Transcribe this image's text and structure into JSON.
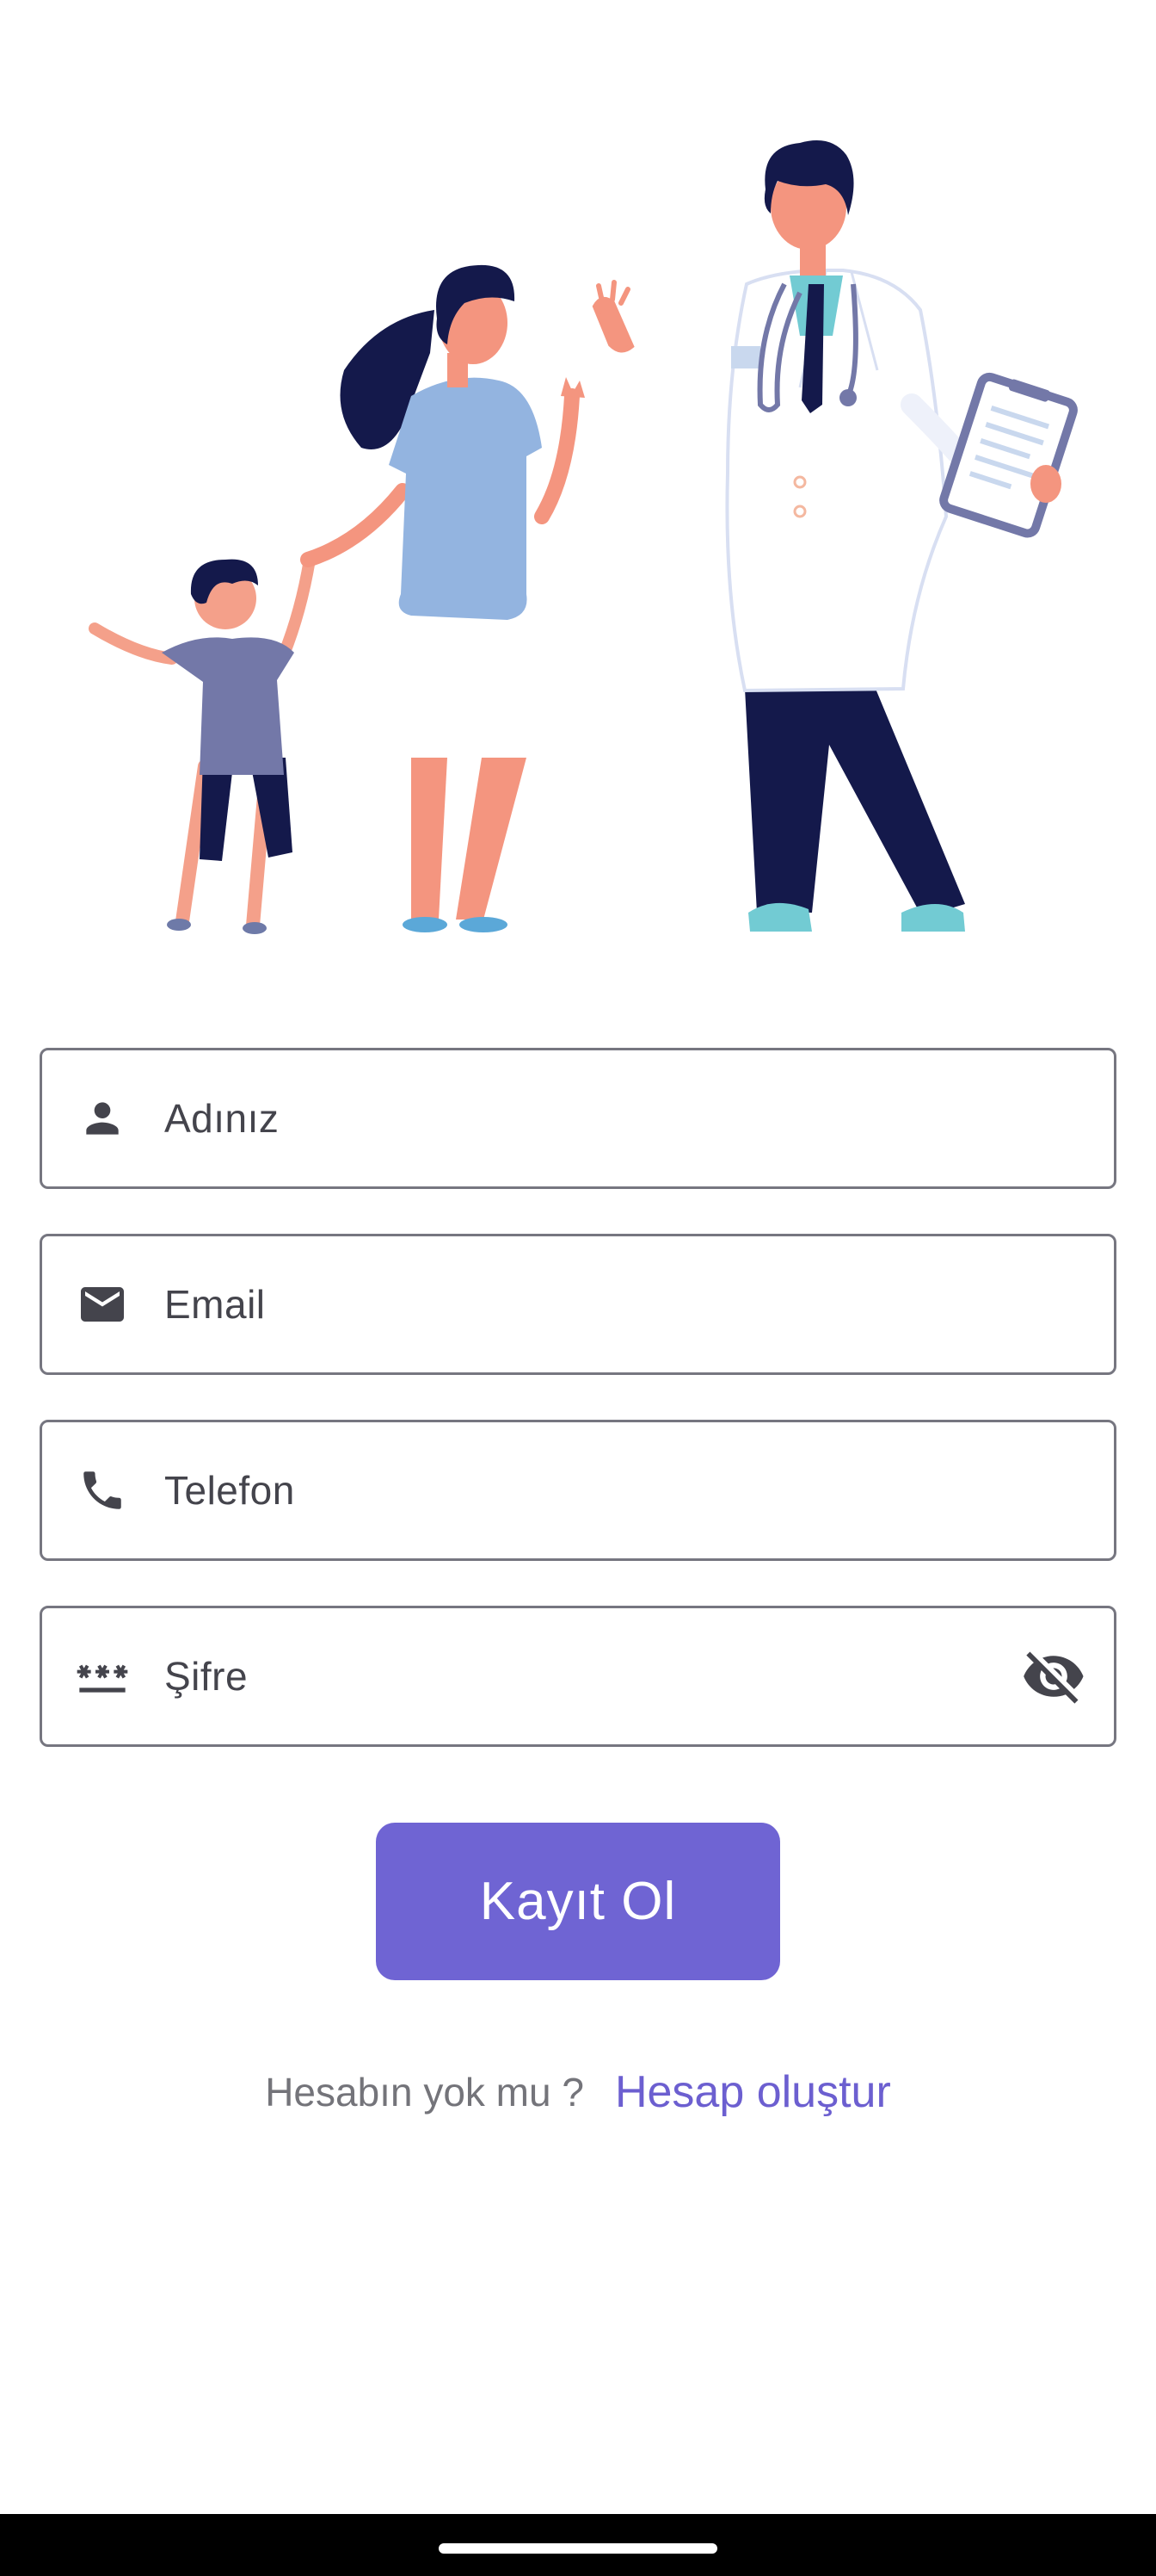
{
  "form": {
    "name": {
      "placeholder": "Adınız",
      "icon": "person-icon"
    },
    "email": {
      "placeholder": "Email",
      "icon": "mail-icon"
    },
    "phone": {
      "placeholder": "Telefon",
      "icon": "phone-icon"
    },
    "password": {
      "placeholder": "Şifre",
      "icon": "password-icon",
      "toggle_icon": "eye-off-icon"
    }
  },
  "submit_label": "Kayıt Ol",
  "footer": {
    "question": "Hesabın yok mu ?",
    "link": "Hesap oluştur"
  },
  "colors": {
    "primary": "#6F64D3",
    "link": "#6C5FD0",
    "field_border": "#767680",
    "text": "#44444C",
    "muted": "#74747A",
    "navbar": "#000000"
  }
}
